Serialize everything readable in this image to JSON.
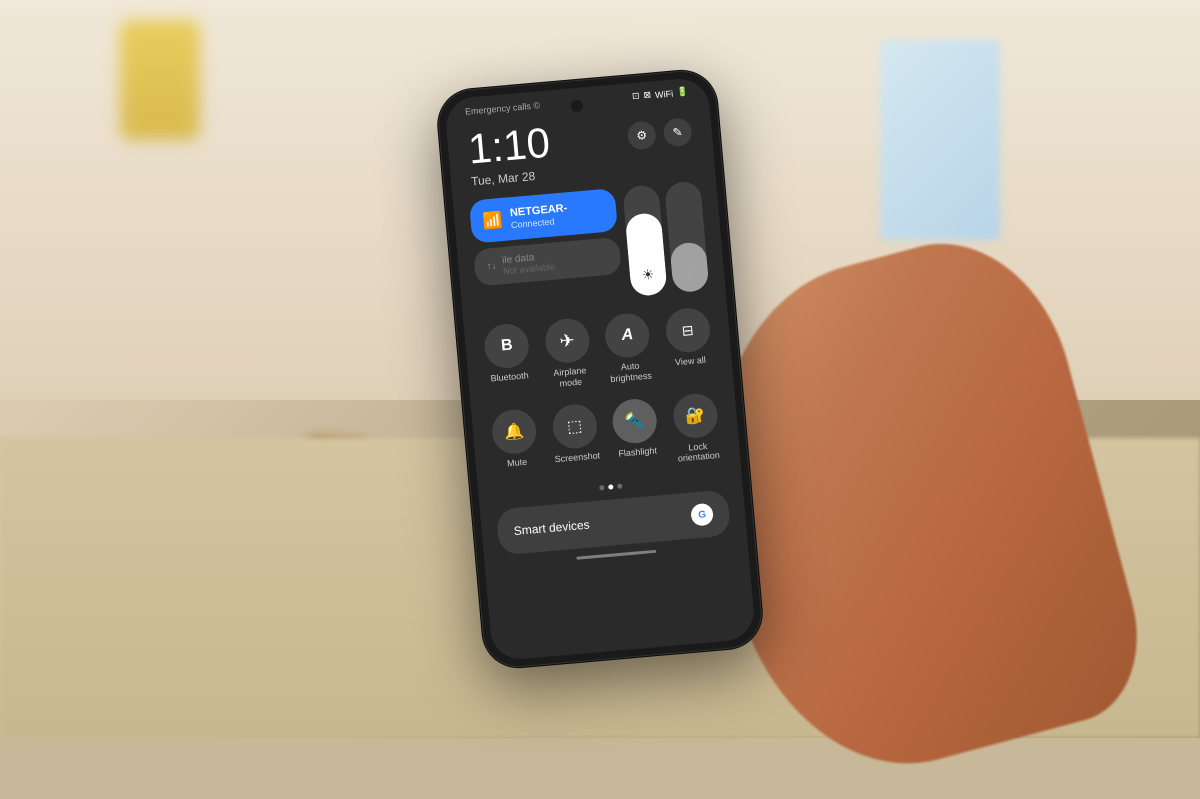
{
  "scene": {
    "background_color": "#c8b89a"
  },
  "phone": {
    "status_bar": {
      "emergency_text": "Emergency calls ©",
      "icons": [
        "⊞",
        "⊡",
        "WiFi",
        "Battery"
      ]
    },
    "clock": {
      "time": "1:10",
      "date": "Tue, Mar 28"
    },
    "header_icons": {
      "settings": "⚙",
      "edit": "✎"
    },
    "wifi_tile": {
      "name": "NETGEAR-",
      "status": "Connected"
    },
    "mobile_tile": {
      "icon": "↑↓",
      "name": "ile data",
      "status": "Not available"
    },
    "sliders": {
      "brightness_level": 75,
      "volume_level": 45
    },
    "quick_actions_row1": [
      {
        "icon": "B",
        "label": "Bluetooth",
        "active": false
      },
      {
        "icon": "✈",
        "label": "Airplane mode",
        "active": false
      },
      {
        "icon": "A",
        "label": "Auto brightness",
        "active": false
      },
      {
        "icon": "⊟",
        "label": "View all",
        "active": false
      }
    ],
    "quick_actions_row2": [
      {
        "icon": "🔔",
        "label": "Mute",
        "active": false
      },
      {
        "icon": "⊞",
        "label": "Screenshot",
        "active": false
      },
      {
        "icon": "🔦",
        "label": "Flashlight",
        "active": true
      },
      {
        "icon": "🔒",
        "label": "Lock orientation",
        "active": false
      }
    ],
    "smart_devices": {
      "label": "Smart devices",
      "google_label": "G"
    },
    "page_dots": [
      false,
      true,
      false
    ]
  }
}
